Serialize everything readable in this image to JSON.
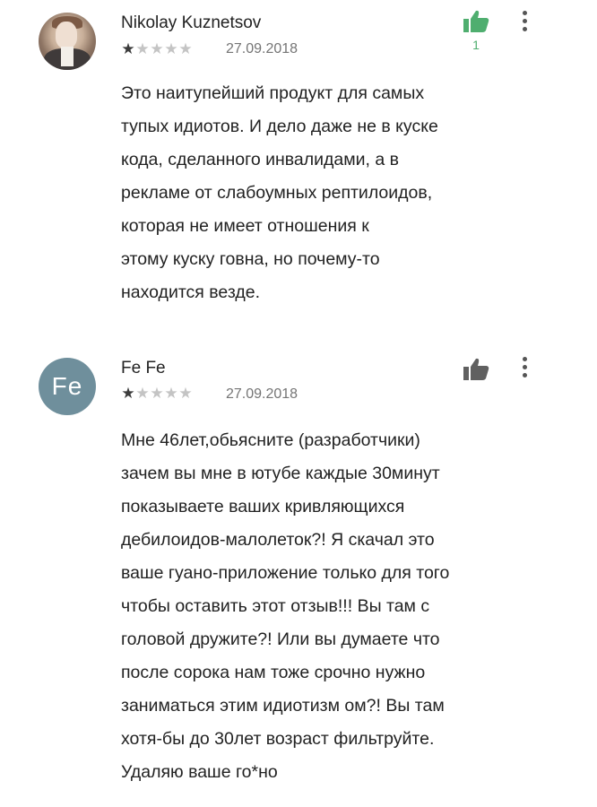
{
  "reviews": [
    {
      "author": "Nikolay Kuznetsov",
      "avatar_type": "photo",
      "rating": 1,
      "rating_max": 5,
      "date": "27.09.2018",
      "helpful_count": "1",
      "helpful_active": true,
      "helpful_color": "#4fae6f",
      "lines": [
        "Это наитупейший продукт для самых",
        "тупых идиотов. И дело даже не в куске",
        "кода, сделанного инвалидами, а в",
        "рекламе от слабоумных рептилоидов,",
        "которая не имеет отношения к",
        "этому куску говна, но почему-то",
        "находится везде."
      ]
    },
    {
      "author": "Fe Fe",
      "avatar_letter": "Fe",
      "avatar_color": "#6f8f9c",
      "rating": 1,
      "rating_max": 5,
      "date": "27.09.2018",
      "helpful_active": false,
      "lines": [
        "Мне 46лет,обьясните (разработчики)",
        "зачем вы мне в ютубе каждые 30минут",
        "показываете ваших кривляющихся",
        "дебилоидов-малолеток?! Я скачал это",
        "ваше гуано-приложение только для того",
        "чтобы оставить этот отзыв!!! Вы там с",
        "головой дружите?! Или вы думаете что",
        "после сорока нам тоже срочно нужно",
        "заниматься этим идиотизм ом?! Вы там",
        "хотя-бы до 30лет возраст фильтруйте.",
        "Удаляю ваше го*но"
      ]
    }
  ],
  "icons": {
    "helpful": "thumbs-up-icon",
    "menu": "more-vertical-icon",
    "star": "star-icon"
  }
}
